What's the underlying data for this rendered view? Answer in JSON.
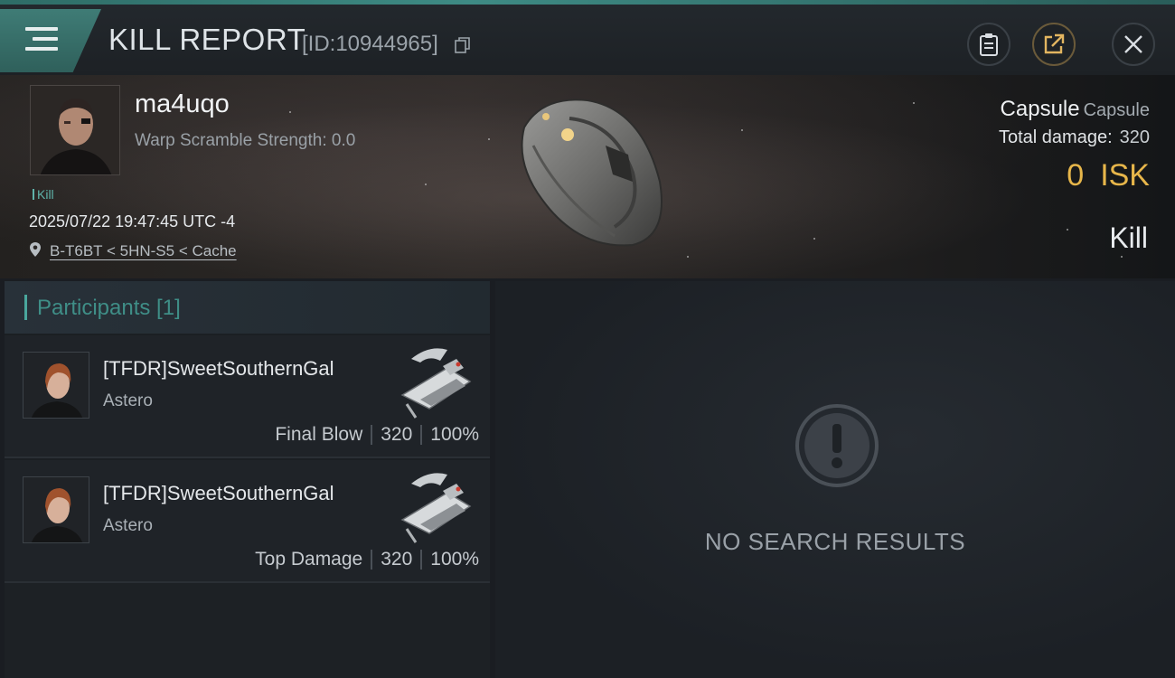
{
  "header": {
    "title": "KILL REPORT",
    "report_id": "[ID:10944965]"
  },
  "victim": {
    "name": "ma4uqo",
    "warp_scramble": "Warp Scramble Strength: 0.0",
    "tag": "Kill",
    "datetime": "2025/07/22 19:47:45 UTC -4",
    "location": "B-T6BT < 5HN-S5 < Cache",
    "ship_name": "Capsule",
    "ship_class": "Capsule",
    "total_damage_label": "Total damage:",
    "total_damage": "320",
    "isk_value": "0",
    "isk_unit": "ISK",
    "kill_type": "Kill"
  },
  "participants": {
    "label": "Participants [1]",
    "rows": [
      {
        "name": "[TFDR]SweetSouthernGal",
        "ship": "Astero",
        "role": "Final Blow",
        "damage": "320",
        "percent": "100%"
      },
      {
        "name": "[TFDR]SweetSouthernGal",
        "ship": "Astero",
        "role": "Top Damage",
        "damage": "320",
        "percent": "100%"
      }
    ]
  },
  "results": {
    "empty_text": "NO SEARCH RESULTS"
  },
  "icons": {
    "menu": "menu-icon",
    "copy": "copy-icon",
    "clipboard": "clipboard-icon",
    "share": "share-icon",
    "close": "close-icon",
    "location": "location-pin-icon",
    "no_results": "exclamation-icon"
  },
  "colors": {
    "accent": "#4aa79d",
    "isk": "#e7b64a",
    "header_tab": "#3f7c76"
  }
}
